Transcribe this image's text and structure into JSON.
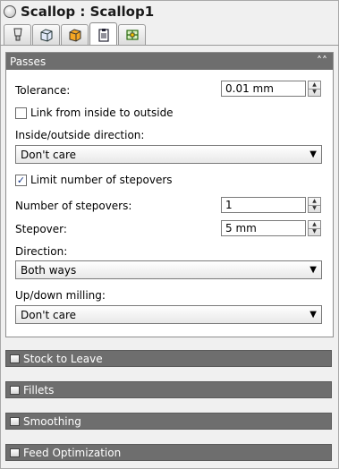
{
  "window": {
    "title": "Scallop : Scallop1"
  },
  "tabs": [
    {
      "icon": "tool-icon"
    },
    {
      "icon": "cube-icon"
    },
    {
      "icon": "orange-cube-icon"
    },
    {
      "icon": "clipboard-icon",
      "active": true
    },
    {
      "icon": "green-grid-icon"
    }
  ],
  "passes": {
    "header": "Passes",
    "tolerance_label": "Tolerance:",
    "tolerance_value": "0.01 mm",
    "link_label": "Link from inside to outside",
    "link_checked": false,
    "inside_outside_label": "Inside/outside direction:",
    "inside_outside_value": "Don't care",
    "limit_label": "Limit number of stepovers",
    "limit_checked": true,
    "num_stepovers_label": "Number of stepovers:",
    "num_stepovers_value": "1",
    "stepover_label": "Stepover:",
    "stepover_value": "5 mm",
    "direction_label": "Direction:",
    "direction_value": "Both ways",
    "updown_label": "Up/down milling:",
    "updown_value": "Don't care"
  },
  "sections": [
    "Stock to Leave",
    "Fillets",
    "Smoothing",
    "Feed Optimization"
  ],
  "colors": {
    "header_bg": "#6e6e6e",
    "panel_bg": "#ffffff",
    "window_bg": "#f0f0f0"
  }
}
